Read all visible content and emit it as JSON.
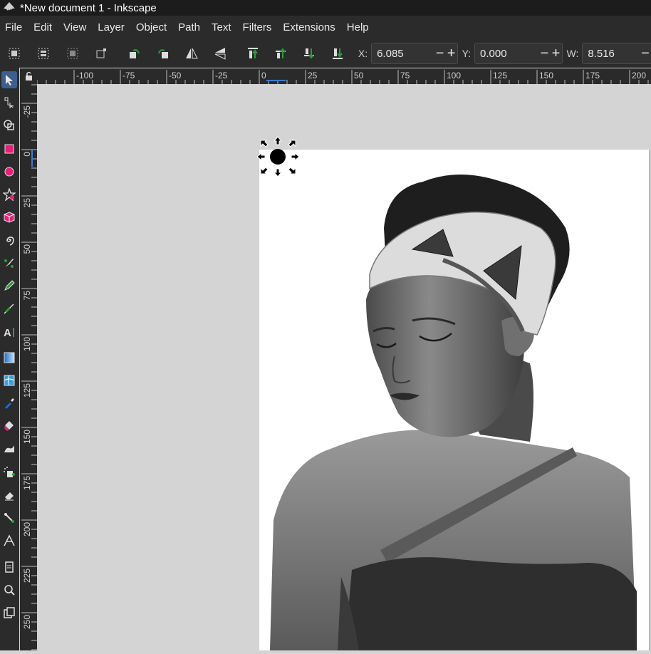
{
  "window": {
    "title": "*New document 1 - Inkscape"
  },
  "menu": [
    "File",
    "Edit",
    "View",
    "Layer",
    "Object",
    "Path",
    "Text",
    "Filters",
    "Extensions",
    "Help"
  ],
  "toolbar": {
    "x_label": "X:",
    "x_value": "6.085",
    "y_label": "Y:",
    "y_value": "0.000",
    "w_label": "W:",
    "w_value": "8.516",
    "minus": "−",
    "plus": "+"
  },
  "hruler_labels": [
    "-100",
    "-75",
    "-50",
    "-25",
    "0",
    "25",
    "50",
    "75",
    "100",
    "125",
    "150",
    "175",
    "200"
  ],
  "vruler_labels": [
    "-25",
    "0",
    "25",
    "50",
    "75",
    "100",
    "125",
    "150",
    "175",
    "200",
    "225",
    "250"
  ],
  "colors": {
    "accent_tool": "#3d5f8f",
    "rect_tool": "#e8207a",
    "guide": "#3a7bd5"
  },
  "tools": [
    "selector-tool",
    "node-tool",
    "shape-builder-tool",
    "rectangle-tool",
    "circle-tool",
    "star-tool",
    "box3d-tool",
    "spiral-tool",
    "pen-tool",
    "pencil-tool",
    "calligraphy-tool",
    "text-tool",
    "gradient-tool",
    "mesh-tool",
    "dropper-tool",
    "paint-bucket-tool",
    "tweak-tool",
    "spray-tool",
    "eraser-tool",
    "connector-tool",
    "lpe-tool",
    "pages-tool",
    "zoom-tool",
    "measure-tool"
  ]
}
